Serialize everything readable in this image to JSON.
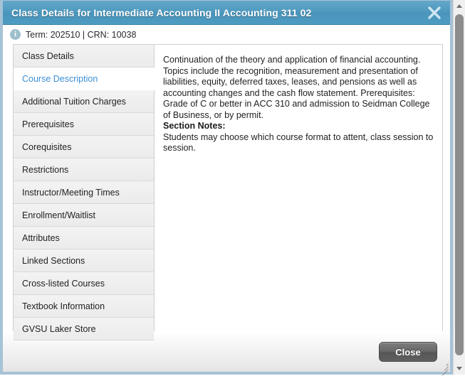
{
  "dialog": {
    "title": "Class Details for Intermediate Accounting II Accounting 311 02",
    "close_icon": "close-x-icon",
    "info": {
      "icon": "info-circle-icon",
      "icon_glyph": "i",
      "text": "Term: 202510 | CRN: 10038"
    },
    "tabs": [
      {
        "label": "Class Details",
        "active": false
      },
      {
        "label": "Course Description",
        "active": true
      },
      {
        "label": "Additional Tuition Charges",
        "active": false
      },
      {
        "label": "Prerequisites",
        "active": false
      },
      {
        "label": "Corequisites",
        "active": false
      },
      {
        "label": "Restrictions",
        "active": false
      },
      {
        "label": "Instructor/Meeting Times",
        "active": false
      },
      {
        "label": "Enrollment/Waitlist",
        "active": false
      },
      {
        "label": "Attributes",
        "active": false
      },
      {
        "label": "Linked Sections",
        "active": false
      },
      {
        "label": "Cross-listed Courses",
        "active": false
      },
      {
        "label": "Textbook Information",
        "active": false
      },
      {
        "label": "GVSU Laker Store",
        "active": false
      }
    ],
    "panel": {
      "description": "Continuation of the theory and application of financial accounting. Topics include the recognition, measurement and presentation of liabilities, equity, deferred taxes, leases, and pensions as well as accounting changes and the cash flow statement. Prerequisites: Grade of C or better in ACC 310 and admission to Seidman College of Business, or by permit.",
      "section_notes_heading": "Section Notes:",
      "section_notes_body": "Students may choose which course format to attent, class session to session."
    },
    "footer": {
      "close_label": "Close",
      "resize_grip_icon": "resize-grip-icon"
    }
  },
  "browser_scrollbar": {
    "up_arrow_icon": "scroll-up-arrow-icon",
    "down_arrow_icon": "scroll-down-arrow-icon",
    "thumb": "scroll-thumb"
  },
  "colors": {
    "titlebar_blue": "#4e99bf",
    "active_tab_text": "#3b8fd4",
    "dialog_border": "#a6c2d6",
    "info_icon": "#9dbfcc",
    "close_button": "#646464"
  }
}
